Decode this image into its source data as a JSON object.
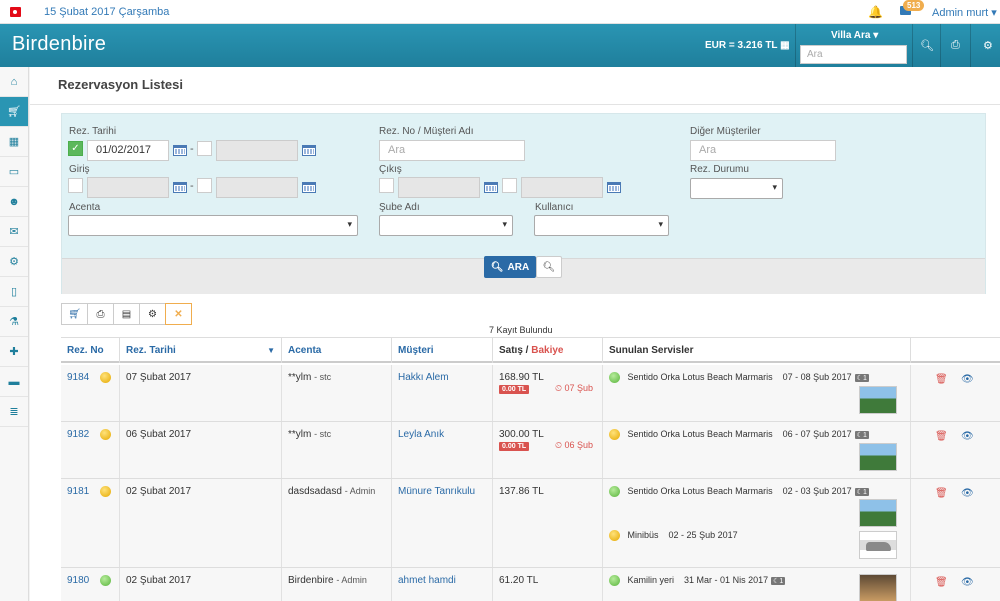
{
  "topbar": {
    "date": "15 Şubat 2017 Çarşamba",
    "notif_count": "513",
    "user": "Admin murt ▾"
  },
  "header": {
    "logo": "Birdenbire",
    "currency": "EUR = 3.216 TL",
    "villa_label": "Villa Ara ▾",
    "search_placeholder": "Ara"
  },
  "page": {
    "title": "Rezervasyon Listesi"
  },
  "filters": {
    "rez_tarihi_label": "Rez. Tarihi",
    "rez_tarihi_value": "01/02/2017",
    "rez_no_label": "Rez. No / Müşteri Adı",
    "rez_no_placeholder": "Ara",
    "diger_label": "Diğer Müşteriler",
    "diger_placeholder": "Ara",
    "giris_label": "Giriş",
    "cikis_label": "Çıkış",
    "rez_durumu_label": "Rez. Durumu",
    "acenta_label": "Acenta",
    "sube_label": "Şube Adı",
    "kullanici_label": "Kullanıcı",
    "search_button": "ARA"
  },
  "results": {
    "found_text": "7 Kayıt Bulundu"
  },
  "table": {
    "headers": {
      "rez_no": "Rez. No",
      "rez_tarihi": "Rez. Tarihi",
      "acenta": "Acenta",
      "musteri": "Müşteri",
      "satis": "Satış /",
      "bakiye": "Bakiye",
      "servisler": "Sunulan Servisler"
    },
    "rows": [
      {
        "no": "9184",
        "date": "07 Şubat 2017",
        "acenta": "**ylm",
        "acenta_sub": "- stc",
        "musteri": "Hakkı Alem",
        "satis": "168.90 TL",
        "bakiye": "0.00 TL",
        "due": "07 Şub",
        "services": [
          {
            "name": "Sentido Orka Lotus Beach Marmaris",
            "dates": "07 - 08 Şub 2017",
            "nights": "1"
          }
        ]
      },
      {
        "no": "9182",
        "date": "06 Şubat 2017",
        "acenta": "**ylm",
        "acenta_sub": "- stc",
        "musteri": "Leyla Anık",
        "satis": "300.00 TL",
        "bakiye": "0.00 TL",
        "due": "06 Şub",
        "services": [
          {
            "name": "Sentido Orka Lotus Beach Marmaris",
            "dates": "06 - 07 Şub 2017",
            "nights": "1"
          }
        ]
      },
      {
        "no": "9181",
        "date": "02 Şubat 2017",
        "acenta": "dasdsadasd",
        "acenta_sub": "- Admin",
        "musteri": "Münure Tanrıkulu",
        "satis": "137.86 TL",
        "services": [
          {
            "name": "Sentido Orka Lotus Beach Marmaris",
            "dates": "02 - 03 Şub 2017",
            "nights": "1"
          },
          {
            "name": "Minibüs",
            "dates": "02 - 25 Şub 2017"
          }
        ]
      },
      {
        "no": "9180",
        "date": "02 Şubat 2017",
        "acenta": "Birdenbire",
        "acenta_sub": "- Admin",
        "musteri": "ahmet hamdi",
        "satis": "61.20 TL",
        "services": [
          {
            "name": "Kamilin yeri",
            "dates": "31 Mar - 01 Nis 2017",
            "nights": "1"
          }
        ]
      }
    ]
  }
}
